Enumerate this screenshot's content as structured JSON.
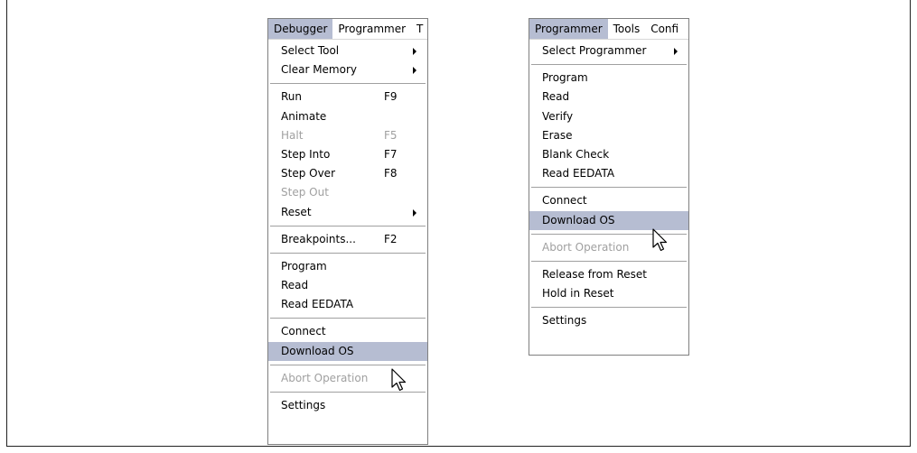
{
  "left_menu": {
    "menubar": [
      "Debugger",
      "Programmer",
      "T"
    ],
    "items": [
      {
        "label": "Select Tool",
        "submenu": true
      },
      {
        "label": "Clear Memory",
        "submenu": true
      },
      {
        "separator": true
      },
      {
        "label": "Run",
        "shortcut": "F9"
      },
      {
        "label": "Animate"
      },
      {
        "label": "Halt",
        "shortcut": "F5",
        "disabled": true
      },
      {
        "label": "Step Into",
        "shortcut": "F7"
      },
      {
        "label": "Step Over",
        "shortcut": "F8"
      },
      {
        "label": "Step Out",
        "disabled": true
      },
      {
        "label": "Reset",
        "submenu": true
      },
      {
        "separator": true
      },
      {
        "label": "Breakpoints...",
        "shortcut": "F2"
      },
      {
        "separator": true
      },
      {
        "label": "Program"
      },
      {
        "label": "Read"
      },
      {
        "label": "Read EEDATA"
      },
      {
        "separator": true
      },
      {
        "label": "Connect"
      },
      {
        "label": "Download OS",
        "highlighted": true
      },
      {
        "separator": true
      },
      {
        "label": "Abort Operation",
        "disabled": true
      },
      {
        "separator": true
      },
      {
        "label": "Settings"
      }
    ]
  },
  "right_menu": {
    "menubar": [
      "Programmer",
      "Tools",
      "Confi"
    ],
    "items": [
      {
        "label": "Select Programmer",
        "submenu": true
      },
      {
        "separator": true
      },
      {
        "label": "Program"
      },
      {
        "label": "Read"
      },
      {
        "label": "Verify"
      },
      {
        "label": "Erase"
      },
      {
        "label": "Blank Check"
      },
      {
        "label": "Read EEDATA"
      },
      {
        "separator": true
      },
      {
        "label": "Connect"
      },
      {
        "label": "Download OS",
        "highlighted": true
      },
      {
        "separator": true
      },
      {
        "label": "Abort Operation",
        "disabled": true
      },
      {
        "separator": true
      },
      {
        "label": "Release from Reset"
      },
      {
        "label": "Hold in Reset"
      },
      {
        "separator": true
      },
      {
        "label": "Settings"
      }
    ]
  },
  "icons": [
    "submenu-arrow-icon",
    "mouse-pointer-icon"
  ],
  "colors": {
    "highlight": "#b6bdd2",
    "disabled_text": "#a0a0a0",
    "separator": "#a0a0a0"
  }
}
